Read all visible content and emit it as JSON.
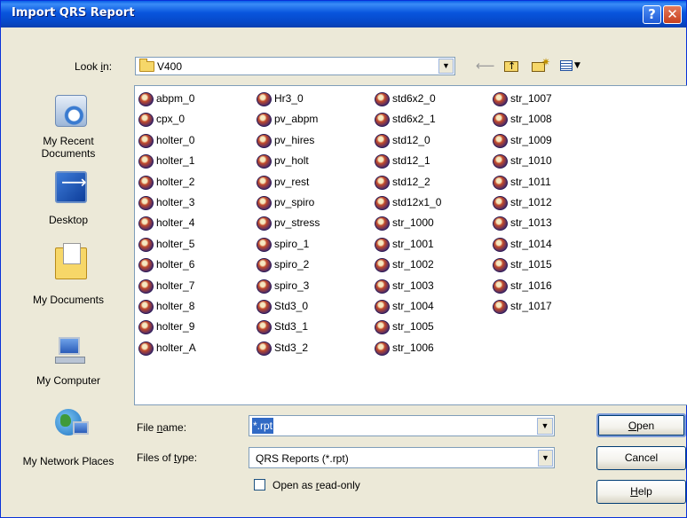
{
  "window": {
    "title": "Import QRS Report",
    "help_glyph": "?",
    "close_glyph": "✕"
  },
  "lookin": {
    "label": "Look in:",
    "value": "V400",
    "icon": "folder-icon"
  },
  "toolbar": {
    "icons": [
      "back-arrow-icon",
      "up-one-level-icon",
      "new-folder-icon",
      "views-menu-icon"
    ]
  },
  "places": [
    {
      "label": "My Recent Documents",
      "icon": "recent-documents-icon"
    },
    {
      "label": "Desktop",
      "icon": "desktop-icon"
    },
    {
      "label": "My Documents",
      "icon": "my-documents-icon"
    },
    {
      "label": "My Computer",
      "icon": "my-computer-icon"
    },
    {
      "label": "My Network Places",
      "icon": "network-places-icon"
    }
  ],
  "files": {
    "columns": [
      [
        "abpm_0",
        "cpx_0",
        "holter_0",
        "holter_1",
        "holter_2",
        "holter_3",
        "holter_4",
        "holter_5",
        "holter_6",
        "holter_7",
        "holter_8",
        "holter_9",
        "holter_A"
      ],
      [
        "Hr3_0",
        "pv_abpm",
        "pv_hires",
        "pv_holt",
        "pv_rest",
        "pv_spiro",
        "pv_stress",
        "spiro_1",
        "spiro_2",
        "spiro_3",
        "Std3_0",
        "Std3_1",
        "Std3_2"
      ],
      [
        "std6x2_0",
        "std6x2_1",
        "std12_0",
        "std12_1",
        "std12_2",
        "std12x1_0",
        "str_1000",
        "str_1001",
        "str_1002",
        "str_1003",
        "str_1004",
        "str_1005",
        "str_1006"
      ],
      [
        "str_1007",
        "str_1008",
        "str_1009",
        "str_1010",
        "str_1011",
        "str_1012",
        "str_1013",
        "str_1014",
        "str_1015",
        "str_1016",
        "str_1017"
      ]
    ]
  },
  "form": {
    "file_name_label": "File name:",
    "file_name_value": "*.rpt",
    "file_type_label": "Files of type:",
    "file_type_value": "QRS Reports (*.rpt)",
    "readonly_label": "Open as read-only",
    "readonly_checked": false
  },
  "buttons": {
    "open": "Open",
    "cancel": "Cancel",
    "help": "Help"
  },
  "colors": {
    "titlebar": "#0855DD",
    "dialog_bg": "#ECE9D8",
    "selection": "#316AC5"
  }
}
